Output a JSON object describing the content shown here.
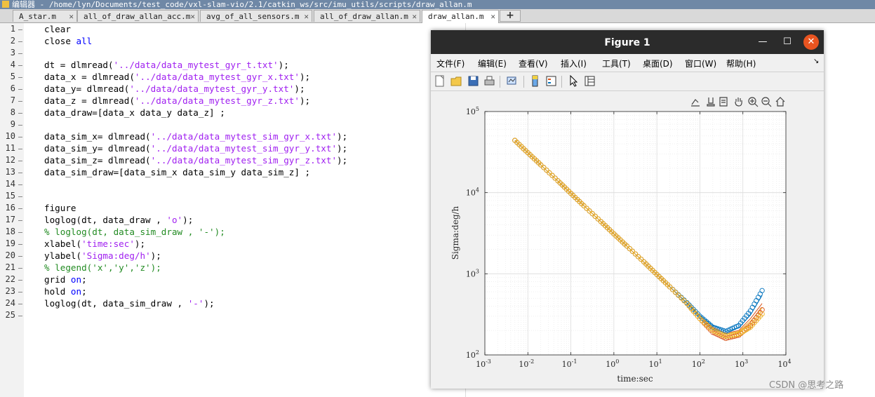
{
  "window": {
    "title": "编辑器 - /home/lyn/Documents/test_code/vxl-slam-vio/2.1/catkin_ws/src/imu_utils/scripts/draw_allan.m"
  },
  "tabs": [
    {
      "label": "A_star.m",
      "active": false
    },
    {
      "label": "all_of_draw_allan_acc.m",
      "active": false
    },
    {
      "label": "avg_of_all_sensors.m",
      "active": false
    },
    {
      "label": "all_of_draw_allan.m",
      "active": false
    },
    {
      "label": "draw_allan.m",
      "active": true
    }
  ],
  "new_tab_label": "+",
  "editor": {
    "lines": [
      {
        "n": "1",
        "code": "clear"
      },
      {
        "n": "2",
        "code": "close all"
      },
      {
        "n": "3",
        "code": ""
      },
      {
        "n": "4",
        "code": "dt = dlmread('../data/data_mytest_gyr_t.txt');"
      },
      {
        "n": "5",
        "code": "data_x = dlmread('../data/data_mytest_gyr_x.txt');"
      },
      {
        "n": "6",
        "code": "data_y= dlmread('../data/data_mytest_gyr_y.txt');"
      },
      {
        "n": "7",
        "code": "data_z = dlmread('../data/data_mytest_gyr_z.txt');"
      },
      {
        "n": "8",
        "code": "data_draw=[data_x data_y data_z] ;"
      },
      {
        "n": "9",
        "code": ""
      },
      {
        "n": "10",
        "code": "data_sim_x= dlmread('../data/data_mytest_sim_gyr_x.txt');"
      },
      {
        "n": "11",
        "code": "data_sim_y= dlmread('../data/data_mytest_sim_gyr_y.txt');"
      },
      {
        "n": "12",
        "code": "data_sim_z= dlmread('../data/data_mytest_sim_gyr_z.txt');"
      },
      {
        "n": "13",
        "code": "data_sim_draw=[data_sim_x data_sim_y data_sim_z] ;"
      },
      {
        "n": "14",
        "code": ""
      },
      {
        "n": "15",
        "code": ""
      },
      {
        "n": "16",
        "code": "figure"
      },
      {
        "n": "17",
        "code": "loglog(dt, data_draw , 'o');"
      },
      {
        "n": "18",
        "code": "% loglog(dt, data_sim_draw , '-');"
      },
      {
        "n": "19",
        "code": "xlabel('time:sec');"
      },
      {
        "n": "20",
        "code": "ylabel('Sigma:deg/h');"
      },
      {
        "n": "21",
        "code": "% legend('x','y','z');"
      },
      {
        "n": "22",
        "code": "grid on;"
      },
      {
        "n": "23",
        "code": "hold on;"
      },
      {
        "n": "24",
        "code": "loglog(dt, data_sim_draw , '-');"
      },
      {
        "n": "25",
        "code": ""
      }
    ]
  },
  "figure": {
    "title": "Figure 1",
    "controls": {
      "minimize": "—",
      "maximize": "☐",
      "close": "✕"
    },
    "menu": [
      "文件(F)",
      "编辑(E)",
      "查看(V)",
      "插入(I)",
      "工具(T)",
      "桌面(D)",
      "窗口(W)",
      "帮助(H)"
    ],
    "menu_overflow": "↘",
    "toolbar_icons": [
      "new-figure-icon",
      "open-file-icon",
      "save-icon",
      "print-icon",
      "link-plot-icon",
      "colorbar-icon",
      "legend-icon",
      "pointer-icon",
      "property-inspector-icon"
    ],
    "axes_toolbar_icons": [
      "brush-icon",
      "data-tip-icon",
      "export-icon",
      "pan-icon",
      "zoom-in-icon",
      "zoom-out-icon",
      "home-icon"
    ]
  },
  "chart_data": {
    "type": "scatter",
    "xscale": "log",
    "yscale": "log",
    "xlim": [
      0.001,
      10000
    ],
    "ylim": [
      100,
      100000
    ],
    "xlabel": "time:sec",
    "ylabel": "Sigma:deg/h",
    "xticks": [
      {
        "base": "10",
        "exp": "-3"
      },
      {
        "base": "10",
        "exp": "-2"
      },
      {
        "base": "10",
        "exp": "-1"
      },
      {
        "base": "10",
        "exp": "0"
      },
      {
        "base": "10",
        "exp": "1"
      },
      {
        "base": "10",
        "exp": "2"
      },
      {
        "base": "10",
        "exp": "3"
      },
      {
        "base": "10",
        "exp": "4"
      }
    ],
    "yticks": [
      {
        "base": "10",
        "exp": "2"
      },
      {
        "base": "10",
        "exp": "3"
      },
      {
        "base": "10",
        "exp": "4"
      },
      {
        "base": "10",
        "exp": "5"
      }
    ],
    "grid": true,
    "colors": {
      "x": "#0072bd",
      "y": "#d95319",
      "z": "#edb120"
    },
    "series": [
      {
        "style": "markers",
        "color": "#0072bd",
        "x": [
          0.005,
          0.01,
          0.02,
          0.05,
          0.1,
          0.2,
          0.5,
          1,
          2,
          5,
          10,
          20,
          50,
          100,
          200,
          400,
          800,
          1500,
          2800
        ],
        "values": [
          44000,
          31000,
          22000,
          14000,
          9800,
          6900,
          4400,
          3100,
          2200,
          1400,
          980,
          690,
          440,
          300,
          220,
          195,
          230,
          350,
          620
        ]
      },
      {
        "style": "markers",
        "color": "#d95319",
        "x": [
          0.005,
          0.01,
          0.02,
          0.05,
          0.1,
          0.2,
          0.5,
          1,
          2,
          5,
          10,
          20,
          50,
          100,
          200,
          400,
          800,
          1500,
          2800
        ],
        "values": [
          44000,
          31000,
          22000,
          14000,
          9800,
          6900,
          4400,
          3100,
          2200,
          1400,
          980,
          690,
          430,
          280,
          190,
          160,
          175,
          230,
          360
        ]
      },
      {
        "style": "markers",
        "color": "#edb120",
        "x": [
          0.005,
          0.01,
          0.02,
          0.05,
          0.1,
          0.2,
          0.5,
          1,
          2,
          5,
          10,
          20,
          50,
          100,
          200,
          400,
          800,
          1500,
          2800
        ],
        "values": [
          44000,
          31000,
          22000,
          14000,
          9800,
          6900,
          4400,
          3100,
          2200,
          1400,
          980,
          690,
          430,
          280,
          200,
          170,
          180,
          220,
          320
        ]
      },
      {
        "style": "line",
        "color": "#0072bd",
        "x": [
          0.005,
          0.01,
          0.1,
          1,
          10,
          100,
          200,
          400,
          800,
          1500,
          2800
        ],
        "values": [
          44000,
          31000,
          9800,
          3100,
          980,
          310,
          230,
          195,
          215,
          310,
          540
        ]
      },
      {
        "style": "line",
        "color": "#d95319",
        "x": [
          0.005,
          0.01,
          0.1,
          1,
          10,
          100,
          200,
          400,
          800,
          1500,
          2800
        ],
        "values": [
          44000,
          31000,
          9800,
          3100,
          980,
          300,
          220,
          185,
          200,
          280,
          430
        ]
      },
      {
        "style": "line",
        "color": "#edb120",
        "x": [
          0.005,
          0.01,
          0.1,
          1,
          10,
          100,
          200,
          400,
          800,
          1500,
          2800
        ],
        "values": [
          44000,
          31000,
          9800,
          3100,
          980,
          300,
          215,
          180,
          195,
          260,
          380
        ]
      }
    ]
  },
  "watermark": "CSDN @思考之路"
}
